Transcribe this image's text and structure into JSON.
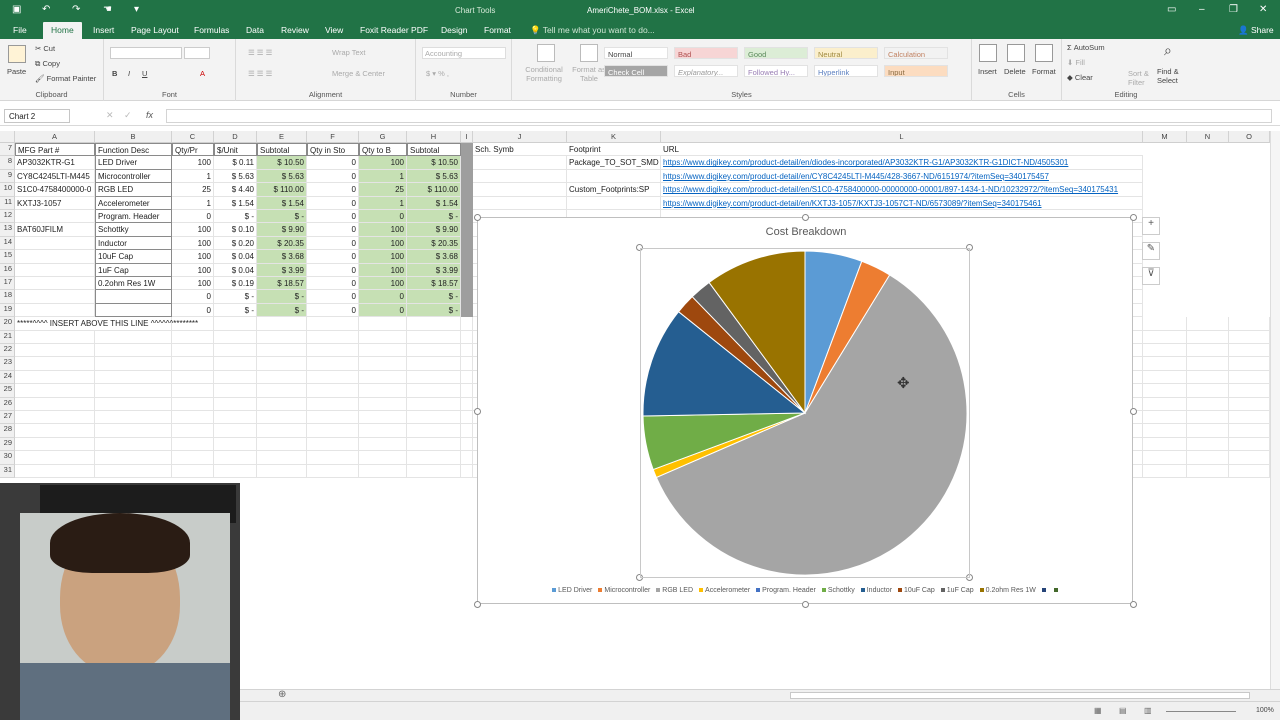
{
  "titlebar": {
    "context_label": "Chart Tools",
    "doc_title": "AmeriChete_BOM.xlsx - Excel"
  },
  "tabs": [
    "File",
    "Home",
    "Insert",
    "Page Layout",
    "Formulas",
    "Data",
    "Review",
    "View",
    "Foxit Reader PDF",
    "Design",
    "Format"
  ],
  "tell_me": "Tell me what you want to do...",
  "share": "Share",
  "ribbon": {
    "clipboard": {
      "label": "Clipboard",
      "paste": "Paste",
      "cut": "Cut",
      "copy": "Copy",
      "format_painter": "Format Painter"
    },
    "font": {
      "label": "Font"
    },
    "alignment": {
      "label": "Alignment",
      "wrap": "Wrap Text",
      "merge": "Merge & Center"
    },
    "number": {
      "label": "Number",
      "format": "Accounting"
    },
    "styles": {
      "label": "Styles",
      "cond": "Conditional Formatting",
      "fmt_table": "Format as Table",
      "cells": [
        "Normal",
        "Bad",
        "Good",
        "Neutral",
        "Calculation",
        "Check Cell",
        "Explanatory...",
        "Followed Hy...",
        "Hyperlink",
        "Input"
      ]
    },
    "cells": {
      "label": "Cells",
      "insert": "Insert",
      "delete": "Delete",
      "format": "Format"
    },
    "editing": {
      "label": "Editing",
      "autosum": "AutoSum",
      "fill": "Fill",
      "clear": "Clear",
      "sort": "Sort & Filter",
      "find": "Find & Select"
    }
  },
  "namebox": "Chart 2",
  "columns": [
    "A",
    "B",
    "C",
    "D",
    "E",
    "F",
    "G",
    "H",
    "I",
    "J",
    "K",
    "L",
    "M",
    "N",
    "O"
  ],
  "header_row": {
    "row": "7",
    "cells": [
      "MFG Part #",
      "Function Desc",
      "Qty/Pr",
      "$/Unit",
      "Subtotal",
      "Qty in Sto",
      "Qty to B",
      "Subtotal",
      "",
      "Sch. Symb",
      "Footprint",
      "URL"
    ]
  },
  "rows": [
    {
      "n": "8",
      "a": "AP3032KTR-G1",
      "b": "LED Driver",
      "c": "100",
      "d": "$ 0.11",
      "e": "$ 10.50",
      "f": "0",
      "g": "100",
      "h": "$ 10.50",
      "k": "Package_TO_SOT_SMD",
      "l": "https://www.digikey.com/product-detail/en/diodes-incorporated/AP3032KTR-G1/AP3032KTR-G1DICT-ND/4505301"
    },
    {
      "n": "9",
      "a": "CY8C4245LTI-M445",
      "b": "Microcontroller",
      "c": "1",
      "d": "$ 5.63",
      "e": "$ 5.63",
      "f": "0",
      "g": "1",
      "h": "$ 5.63",
      "k": "",
      "l": "https://www.digikey.com/product-detail/en/CY8C4245LTI-M445/428-3667-ND/6151974/?itemSeq=340175457"
    },
    {
      "n": "10",
      "a": "S1C0-4758400000-0",
      "b": "RGB LED",
      "c": "25",
      "d": "$ 4.40",
      "e": "$ 110.00",
      "f": "0",
      "g": "25",
      "h": "$ 110.00",
      "k": "Custom_Footprints:SP",
      "l": "https://www.digikey.com/product-detail/en/S1C0-4758400000-00000000-00001/897-1434-1-ND/10232972/?itemSeq=340175431"
    },
    {
      "n": "11",
      "a": "KXTJ3-1057",
      "b": "Accelerometer",
      "c": "1",
      "d": "$ 1.54",
      "e": "$ 1.54",
      "f": "0",
      "g": "1",
      "h": "$ 1.54",
      "k": "",
      "l": "https://www.digikey.com/product-detail/en/KXTJ3-1057/KXTJ3-1057CT-ND/6573089/?itemSeq=340175461"
    },
    {
      "n": "12",
      "a": "",
      "b": "Program. Header",
      "c": "0",
      "d": "$ -",
      "e": "$ -",
      "f": "0",
      "g": "0",
      "h": "$ -",
      "k": "",
      "l": ""
    },
    {
      "n": "13",
      "a": "BAT60JFILM",
      "b": "Schottky",
      "c": "100",
      "d": "$ 0.10",
      "e": "$ 9.90",
      "f": "0",
      "g": "100",
      "h": "$ 9.90",
      "k": "",
      "l": ""
    },
    {
      "n": "14",
      "a": "",
      "b": "Inductor",
      "c": "100",
      "d": "$ 0.20",
      "e": "$ 20.35",
      "f": "0",
      "g": "100",
      "h": "$ 20.35",
      "k": "",
      "l": ""
    },
    {
      "n": "15",
      "a": "",
      "b": "10uF Cap",
      "c": "100",
      "d": "$ 0.04",
      "e": "$ 3.68",
      "f": "0",
      "g": "100",
      "h": "$ 3.68",
      "k": "",
      "l": ""
    },
    {
      "n": "16",
      "a": "",
      "b": "1uF Cap",
      "c": "100",
      "d": "$ 0.04",
      "e": "$ 3.99",
      "f": "0",
      "g": "100",
      "h": "$ 3.99",
      "k": "",
      "l": ""
    },
    {
      "n": "17",
      "a": "",
      "b": "0.2ohm Res 1W",
      "c": "100",
      "d": "$ 0.19",
      "e": "$ 18.57",
      "f": "0",
      "g": "100",
      "h": "$ 18.57",
      "k": "",
      "l": ""
    },
    {
      "n": "18",
      "a": "",
      "b": "",
      "c": "0",
      "d": "$ -",
      "e": "$ -",
      "f": "0",
      "g": "0",
      "h": "$ -",
      "k": "",
      "l": ""
    },
    {
      "n": "19",
      "a": "",
      "b": "",
      "c": "0",
      "d": "$ -",
      "e": "$ -",
      "f": "0",
      "g": "0",
      "h": "$ -",
      "k": "",
      "l": ""
    }
  ],
  "row20_text": "*****^^^^ INSERT ABOVE THIS LINE ^^^^^^********",
  "empty_rows": [
    "20",
    "21",
    "22",
    "23",
    "24",
    "25",
    "26",
    "27",
    "28",
    "29",
    "30",
    "31"
  ],
  "chart_data": {
    "type": "pie",
    "title": "Cost Breakdown",
    "categories": [
      "LED Driver",
      "Microcontroller",
      "RGB LED",
      "Accelerometer",
      "Program. Header",
      "Schottky",
      "Inductor",
      "10uF Cap",
      "1uF Cap",
      "0.2ohm Res 1W",
      "",
      ""
    ],
    "values": [
      10.5,
      5.63,
      110.0,
      1.54,
      0,
      9.9,
      20.35,
      3.68,
      3.99,
      18.57,
      0,
      0
    ],
    "colors": [
      "#5b9bd5",
      "#ed7d31",
      "#a5a5a5",
      "#ffc000",
      "#4472c4",
      "#70ad47",
      "#255e91",
      "#9e480e",
      "#636363",
      "#997300",
      "#264478",
      "#43682b"
    ],
    "legend_position": "bottom"
  },
  "status": {
    "zoom": "100%"
  }
}
